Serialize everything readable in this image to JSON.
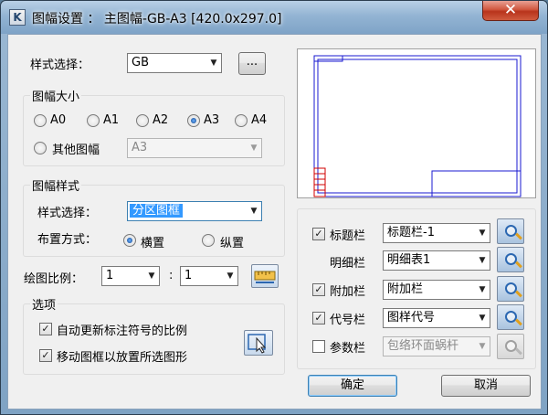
{
  "window": {
    "title": "图幅设置 ： 主图幅-GB-A3 [420.0x297.0]",
    "close_glyph": "✕",
    "app_icon_glyph": "K"
  },
  "style_select": {
    "label": "样式选择：",
    "value": "GB",
    "browse_label": "..."
  },
  "size_group": {
    "title": "图幅大小",
    "options": [
      "A0",
      "A1",
      "A2",
      "A3",
      "A4"
    ],
    "selected": "A3",
    "other_label": "其他图幅",
    "other_value": "A3"
  },
  "frame_style_group": {
    "title": "图幅样式",
    "style_label": "样式选择：",
    "style_value": "分区图框",
    "layout_label": "布置方式：",
    "layout_options": [
      "横置",
      "纵置"
    ],
    "layout_selected": "横置"
  },
  "scale": {
    "label": "绘图比例：",
    "left_value": "1",
    "separator": ":",
    "right_value": "1"
  },
  "options_group": {
    "title": "选项",
    "items": [
      {
        "label": "自动更新标注符号的比例",
        "checked": true
      },
      {
        "label": "移动图框以放置所选图形",
        "checked": true
      }
    ]
  },
  "right_panel": {
    "rows": [
      {
        "label": "标题栏",
        "has_check": true,
        "checked": true,
        "value": "标题栏-1",
        "enabled": true
      },
      {
        "label": "明细栏",
        "has_check": false,
        "checked": false,
        "value": "明细表1",
        "enabled": true
      },
      {
        "label": "附加栏",
        "has_check": true,
        "checked": true,
        "value": "附加栏",
        "enabled": true
      },
      {
        "label": "代号栏",
        "has_check": true,
        "checked": true,
        "value": "图样代号",
        "enabled": true
      },
      {
        "label": "参数栏",
        "has_check": true,
        "checked": false,
        "value": "包络环面蜗杆",
        "enabled": false
      }
    ]
  },
  "buttons": {
    "ok": "确定",
    "cancel": "取消"
  },
  "colors": {
    "preview_border_blue": "#1a1ad0",
    "preview_zone_red": "#d00000",
    "selection_blue": "#3399ff"
  }
}
